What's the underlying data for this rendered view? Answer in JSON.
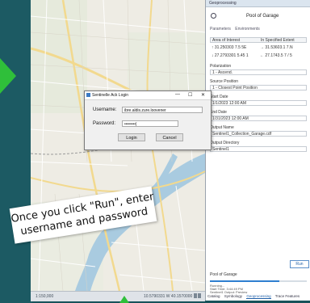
{
  "window": {
    "pane_top_label": "Geoprocessing",
    "title": "Pool of Garage"
  },
  "dialog": {
    "title": "Sentinelle Ack Login",
    "minimize": "—",
    "maximize": "☐",
    "close": "✕",
    "username_label": "Username:",
    "username_value": "ibre.aldis.zure.loovener",
    "password_label": "Password:",
    "password_value": "••••••••|",
    "login_label": "Login",
    "cancel_label": "Cancel"
  },
  "caption": {
    "line1": "Once you click \"Run\", enter",
    "line2": "username and password"
  },
  "pane": {
    "tabs": [
      "Parameters",
      "Environments"
    ],
    "area_of_interest_label": "Area of Interest",
    "area_col2": "In Specified Extent",
    "rows": [
      [
        "↑ 31.250303 7.5 5E",
        "→ 31.53603.1 7.N"
      ],
      [
        "↓ 27.2793301 5.45 1",
        "← 27.1743.5 7 / 5"
      ]
    ],
    "fields": [
      {
        "label": "Polarization",
        "value": "1 - Ascend."
      },
      {
        "label": "Source Position",
        "value": "1 - Closest Point Position"
      },
      {
        "label": "Start Date",
        "value": "1/1/2023 12:00 AM"
      },
      {
        "label": "End Date",
        "value": "1/31/2023 12:00 AM"
      },
      {
        "label": "Output Name",
        "value": "Sentinel1_Collection_Garage.cdf"
      },
      {
        "label": "Output Directory",
        "value": "Sentinel1"
      }
    ],
    "run_label": "Run",
    "progress_title": "Pool of Garage",
    "progress_lines": [
      "Running...",
      "Start Time: 3:44:49 PM",
      "Sentinel1 Output: Preview"
    ],
    "progress_fraction": 0.72,
    "bottom_tabs": [
      "Catalog",
      "Symbology",
      "Geoprocessing",
      "Trace Features"
    ],
    "active_tab_index": 2
  },
  "map_footer": {
    "scale": "1:150,000",
    "coords": "10.5790331 W 40.1570000 N"
  },
  "colors": {
    "accent": "#2fbf3a",
    "link": "#1f5fa8",
    "background": "#18525a"
  }
}
